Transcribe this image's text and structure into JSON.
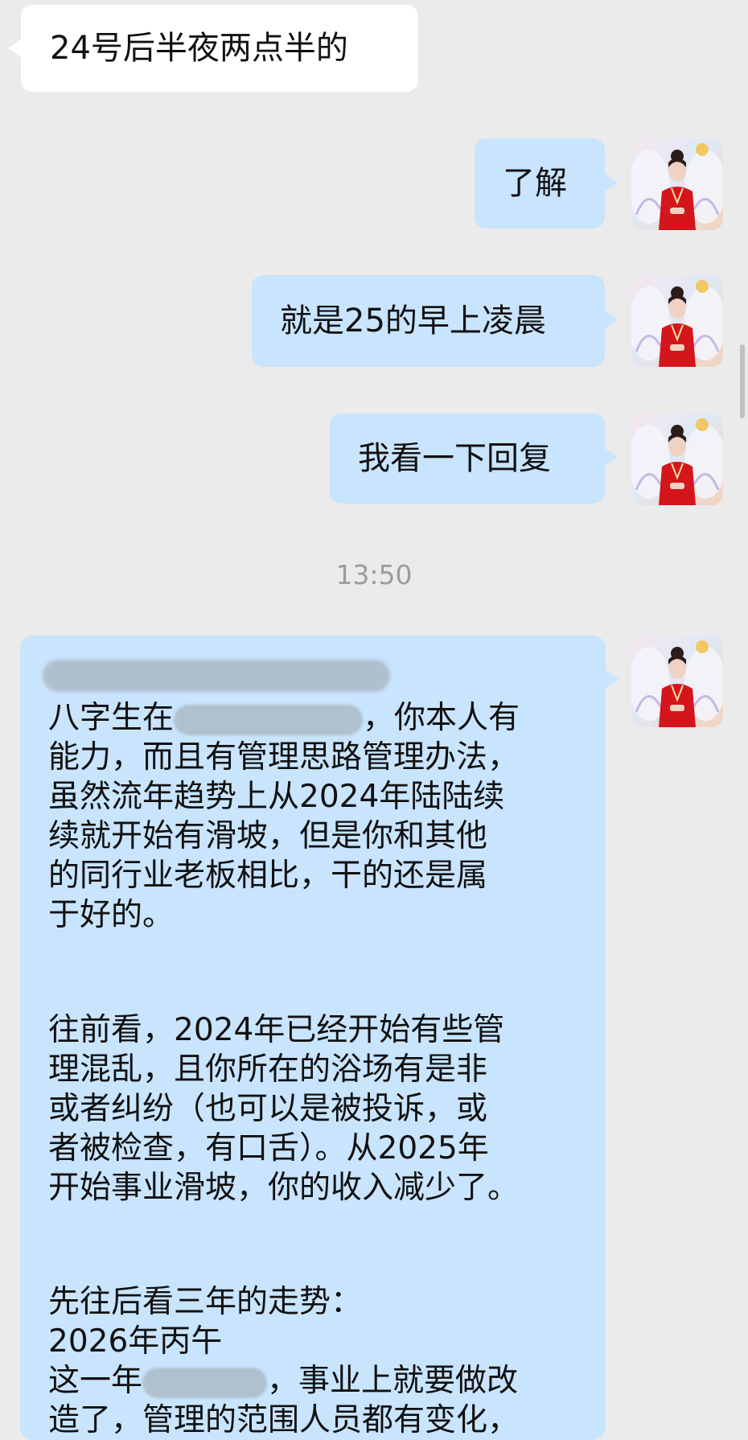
{
  "messages": {
    "msg1": {
      "text": "24号后半夜两点半的"
    },
    "msg2": {
      "text": "了解"
    },
    "msg3": {
      "text": "就是25的早上凌晨"
    },
    "msg4": {
      "text": "我看一下回复"
    }
  },
  "timestamp": "13:50",
  "long_reply": {
    "p1": {
      "l1a": "八字生在",
      "l1b": "，你本人有",
      "l2": "能力，而且有管理思路管理办法，",
      "l3": "虽然流年趋势上从2024年陆陆续",
      "l4": "续就开始有滑坡，但是你和其他",
      "l5": "的同行业老板相比，干的还是属",
      "l6": "于好的。"
    },
    "p2": {
      "l1": "往前看，2024年已经开始有些管",
      "l2": "理混乱，且你所在的浴场有是非",
      "l3": "或者纠纷（也可以是被投诉，或",
      "l4": "者被检查，有口舌）。从2025年",
      "l5": "开始事业滑坡，你的收入减少了。"
    },
    "p3": {
      "l1": "先往后看三年的走势：",
      "l2": "2026年丙午",
      "l3a": "这一年",
      "l3b": "，事业上就要做改",
      "l4": "造了，管理的范围人员都有变化，"
    }
  },
  "colors": {
    "background": "#ebebec",
    "incoming_bubble": "#ffffff",
    "outgoing_bubble": "#c9e4fd"
  },
  "icons": {
    "avatar": "avatar-red-robed-woman-with-white-wings"
  }
}
